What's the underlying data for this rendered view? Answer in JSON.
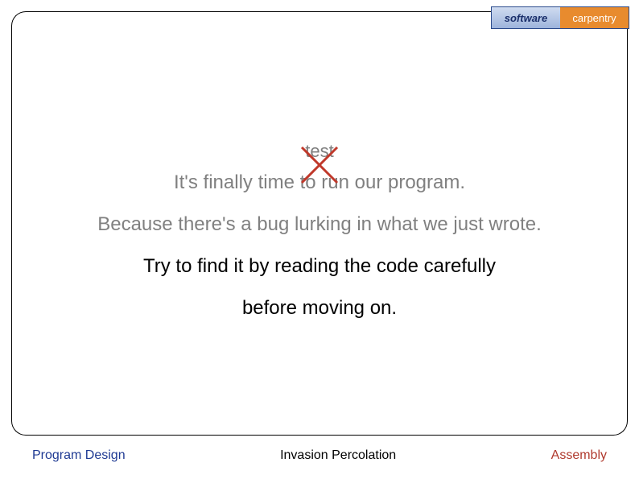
{
  "logo": {
    "left": "software",
    "right": "carpentry"
  },
  "content": {
    "test_label": "test",
    "line1_prefix": "It's finally time to ",
    "line1_word": "run",
    "line1_suffix": " our program.",
    "line2": "Because there's a bug lurking in what we just wrote.",
    "line3": "Try to find it by reading the code carefully",
    "line4": "before moving on."
  },
  "footer": {
    "left": "Program Design",
    "center": "Invasion Percolation",
    "right": "Assembly"
  },
  "colors": {
    "grey": "#808080",
    "cross": "#c0392b",
    "footer_left": "#1f3a93",
    "footer_right": "#b03a2e"
  }
}
